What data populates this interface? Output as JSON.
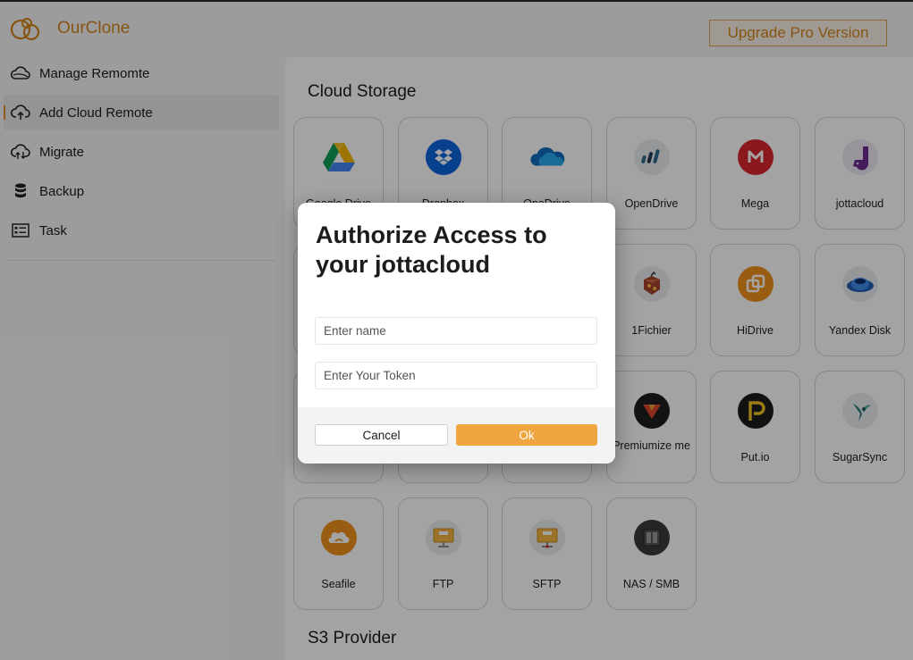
{
  "app": {
    "title": "OurClone",
    "brand_color": "#d4861c",
    "logo_icon": "ourclone-logo"
  },
  "header": {
    "upgrade_label": "Upgrade Pro Version"
  },
  "sidebar": {
    "active_accent": "#e8912a",
    "items": [
      {
        "label": "Manage Remomte",
        "icon": "cloud-outline-icon",
        "active": false
      },
      {
        "label": "Add Cloud Remote",
        "icon": "cloud-upload-icon",
        "active": true
      },
      {
        "label": "Migrate",
        "icon": "cloud-sync-icon",
        "active": false
      },
      {
        "label": "Backup",
        "icon": "database-icon",
        "active": false
      },
      {
        "label": "Task",
        "icon": "task-list-icon",
        "active": false
      }
    ]
  },
  "main": {
    "cloud_storage_title": "Cloud Storage",
    "s3_title": "S3 Provider",
    "providers": [
      {
        "label": "Google Drive",
        "icon": "google-drive-icon"
      },
      {
        "label": "Dropbox",
        "icon": "dropbox-icon"
      },
      {
        "label": "OneDrive",
        "icon": "onedrive-icon"
      },
      {
        "label": "OpenDrive",
        "icon": "opendrive-icon"
      },
      {
        "label": "Mega",
        "icon": "mega-icon"
      },
      {
        "label": "jottacloud",
        "icon": "jottacloud-icon"
      },
      {
        "label": "",
        "icon": ""
      },
      {
        "label": "",
        "icon": ""
      },
      {
        "label": "",
        "icon": ""
      },
      {
        "label": "1Fichier",
        "icon": "1fichier-icon"
      },
      {
        "label": "HiDrive",
        "icon": "hidrive-icon"
      },
      {
        "label": "Yandex Disk",
        "icon": "yandex-disk-icon"
      },
      {
        "label": "",
        "icon": ""
      },
      {
        "label": "",
        "icon": ""
      },
      {
        "label": "",
        "icon": ""
      },
      {
        "label": "Premiumize me",
        "icon": "premiumize-icon"
      },
      {
        "label": "Put.io",
        "icon": "putio-icon"
      },
      {
        "label": "SugarSync",
        "icon": "sugarsync-icon"
      },
      {
        "label": "Seafile",
        "icon": "seafile-icon"
      },
      {
        "label": "FTP",
        "icon": "ftp-icon"
      },
      {
        "label": "SFTP",
        "icon": "sftp-icon"
      },
      {
        "label": "NAS / SMB",
        "icon": "nas-smb-icon"
      }
    ]
  },
  "dialog": {
    "title": "Authorize Access to your jottacloud",
    "name_placeholder": "Enter name",
    "token_placeholder": "Enter Your Token",
    "cancel_label": "Cancel",
    "ok_label": "Ok",
    "ok_color": "#f0a640"
  }
}
